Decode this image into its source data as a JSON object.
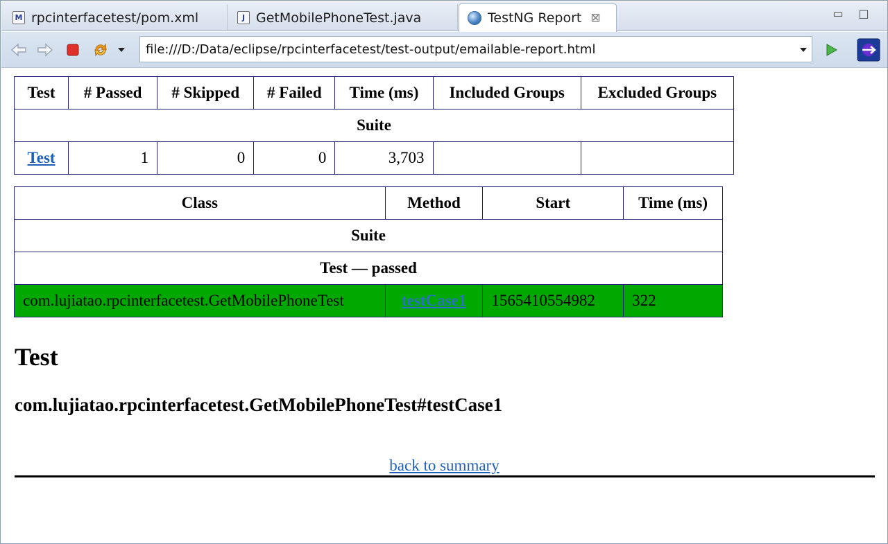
{
  "tabs": [
    {
      "label": "rpcinterfacetest/pom.xml",
      "icon": "maven-xml-file-icon",
      "icon_glyph": "M"
    },
    {
      "label": "GetMobilePhoneTest.java",
      "icon": "java-file-icon",
      "icon_glyph": "J"
    },
    {
      "label": "TestNG Report",
      "icon": "globe-icon",
      "close": "⊠"
    }
  ],
  "window": {
    "minimize": "▭",
    "maximize": "□"
  },
  "toolbar": {
    "back": "back-arrow-icon",
    "forward": "forward-arrow-icon",
    "stop": "stop-icon",
    "refresh": "refresh-icon",
    "menu": "dropdown-arrow-icon",
    "go": "go-play-icon",
    "open_external": "external-browser-icon",
    "url": "file:///D:/Data/eclipse/rpcinterfacetest/test-output/emailable-report.html"
  },
  "summary_table": {
    "headers": [
      "Test",
      "# Passed",
      "# Skipped",
      "# Failed",
      "Time (ms)",
      "Included Groups",
      "Excluded Groups"
    ],
    "suite_label": "Suite",
    "row": {
      "test": "Test",
      "passed": "1",
      "skipped": "0",
      "failed": "0",
      "time": "3,703",
      "included": "",
      "excluded": ""
    }
  },
  "methods_table": {
    "headers": [
      "Class",
      "Method",
      "Start",
      "Time (ms)"
    ],
    "suite_label": "Suite",
    "status_label": "Test — passed",
    "row": {
      "class": "com.lujiatao.rpcinterfacetest.GetMobilePhoneTest",
      "method": "testCase1",
      "start": "1565410554982",
      "time": "322"
    }
  },
  "colors": {
    "passed_row": "#00a800",
    "table_border": "#1f1f7a",
    "link": "#1f5fb8"
  },
  "detail": {
    "test_heading": "Test",
    "method_heading": "com.lujiatao.rpcinterfacetest.GetMobilePhoneTest#testCase1",
    "back_link": "back to summary"
  }
}
